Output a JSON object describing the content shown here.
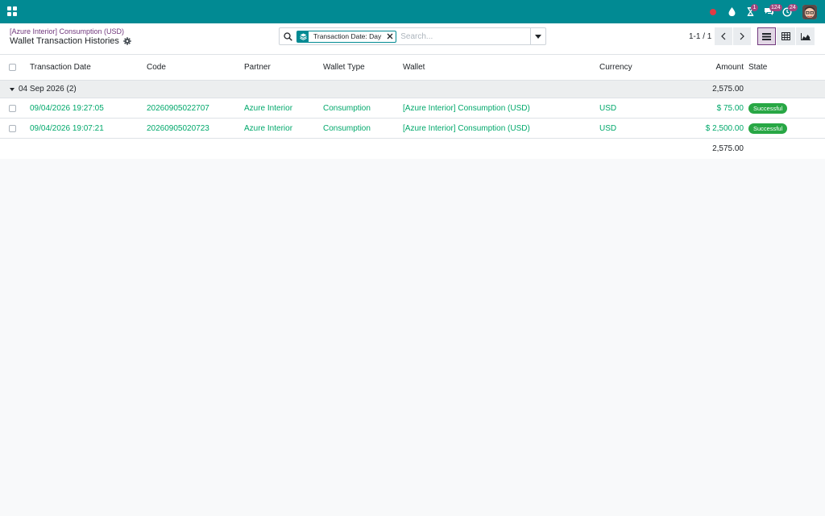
{
  "navbar": {
    "systray": {
      "activities_count": "1",
      "messages_count": "124",
      "timesheet_count": "24"
    }
  },
  "control": {
    "breadcrumb": "[Azure Interior] Consumption (USD)",
    "title": "Wallet Transaction Histories",
    "search": {
      "facet": "Transaction Date: Day",
      "placeholder": "Search..."
    },
    "pager": "1-1 / 1"
  },
  "list": {
    "columns": {
      "date": "Transaction Date",
      "code": "Code",
      "partner": "Partner",
      "wallet_type": "Wallet Type",
      "wallet": "Wallet",
      "currency": "Currency",
      "amount": "Amount",
      "state": "State"
    },
    "group": {
      "label": "04 Sep 2026 (2)",
      "total": "2,575.00"
    },
    "rows": [
      {
        "date": "09/04/2026 19:27:05",
        "code": "20260905022707",
        "partner": "Azure Interior",
        "wallet_type": "Consumption",
        "wallet": "[Azure Interior] Consumption (USD)",
        "currency": "USD",
        "amount": "$ 75.00",
        "state": "Successful"
      },
      {
        "date": "09/04/2026 19:07:21",
        "code": "20260905020723",
        "partner": "Azure Interior",
        "wallet_type": "Consumption",
        "wallet": "[Azure Interior] Consumption (USD)",
        "currency": "USD",
        "amount": "$ 2,500.00",
        "state": "Successful"
      }
    ],
    "footer_total": "2,575.00"
  },
  "colors": {
    "navbar": "#018a93",
    "link": "#00a86b",
    "badge_success": "#28a745",
    "breadcrumb": "#71387d"
  }
}
